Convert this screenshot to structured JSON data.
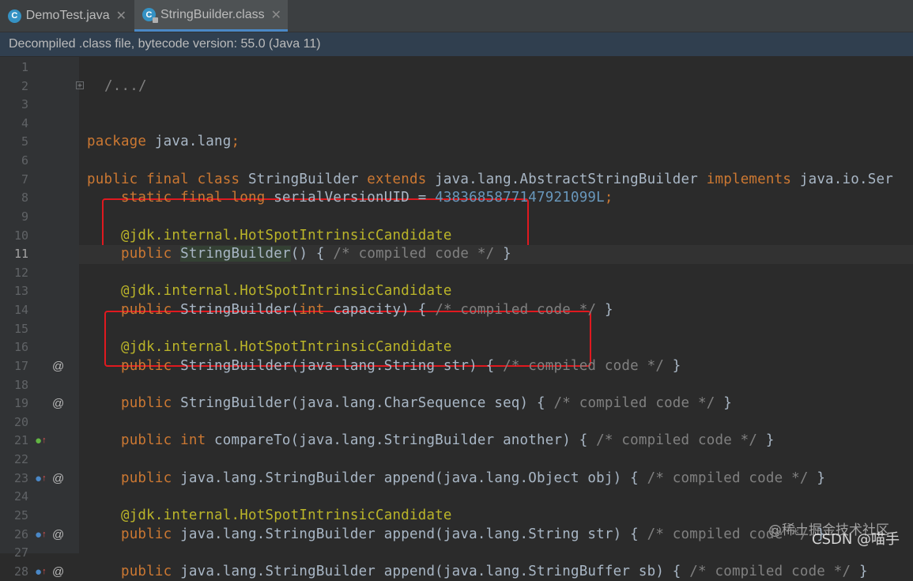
{
  "tabs": [
    {
      "label": "DemoTest.java",
      "icon": "java-class-icon",
      "active": false
    },
    {
      "label": "StringBuilder.class",
      "icon": "compiled-class-icon",
      "active": true
    }
  ],
  "notice": "Decompiled .class file, bytecode version: 55.0 (Java 11)",
  "lines": [
    {
      "n": "1",
      "html": ""
    },
    {
      "n": "2",
      "html": "<span class='cm' style='margin-left:22px'>/.../</span>"
    },
    {
      "n": "3",
      "html": ""
    },
    {
      "n": "4",
      "html": ""
    },
    {
      "n": "5",
      "html": "<span class='kw'>package</span> java.lang<span class='kw'>;</span>"
    },
    {
      "n": "6",
      "html": ""
    },
    {
      "n": "7",
      "html": "<span class='kw'>public final class</span> StringBuilder <span class='kw'>extends</span> java.lang.AbstractStringBuilder <span class='kw'>implements</span> java.io.Ser"
    },
    {
      "n": "8",
      "html": "    <span class='kw'>static final long</span> serialVersionUID = <span class='num'>4383685877147921099L</span><span class='kw'>;</span>"
    },
    {
      "n": "9",
      "html": ""
    },
    {
      "n": "10",
      "html": "    <span class='an'>@jdk.internal.HotSpotIntrinsicCandidate</span>"
    },
    {
      "n": "11",
      "html": "    <span class='kw'>public</span> <span class='hl'>StringBuilder</span>() { <span class='cm'>/* compiled code */</span> }"
    },
    {
      "n": "12",
      "html": ""
    },
    {
      "n": "13",
      "html": "    <span class='an'>@jdk.internal.HotSpotIntrinsicCandidate</span>"
    },
    {
      "n": "14",
      "html": "    <span class='kw'>public</span> StringBuilder(<span class='kw'>int</span> capacity) { <span class='cm'>/* compiled code */</span> }"
    },
    {
      "n": "15",
      "html": ""
    },
    {
      "n": "16",
      "html": "    <span class='an'>@jdk.internal.HotSpotIntrinsicCandidate</span>"
    },
    {
      "n": "17",
      "html": "    <span class='kw'>public</span> StringBuilder(java.lang.String str) { <span class='cm'>/* compiled code */</span> }"
    },
    {
      "n": "18",
      "html": ""
    },
    {
      "n": "19",
      "html": "    <span class='kw'>public</span> StringBuilder(java.lang.CharSequence seq) { <span class='cm'>/* compiled code */</span> }"
    },
    {
      "n": "20",
      "html": ""
    },
    {
      "n": "21",
      "html": "    <span class='kw'>public int</span> compareTo(java.lang.StringBuilder another) { <span class='cm'>/* compiled code */</span> }"
    },
    {
      "n": "22",
      "html": ""
    },
    {
      "n": "23",
      "html": "    <span class='kw'>public</span> java.lang.StringBuilder append(java.lang.Object obj) { <span class='cm'>/* compiled code */</span> }"
    },
    {
      "n": "24",
      "html": ""
    },
    {
      "n": "25",
      "html": "    <span class='an'>@jdk.internal.HotSpotIntrinsicCandidate</span>"
    },
    {
      "n": "26",
      "html": "    <span class='kw'>public</span> java.lang.StringBuilder append(java.lang.String str) { <span class='cm'>/* compiled code */</span> }"
    },
    {
      "n": "27",
      "html": ""
    },
    {
      "n": "28",
      "html": "    <span class='kw'>public</span> java.lang.StringBuilder append(java.lang.StringBuffer sb) { <span class='cm'>/* compiled code */</span> }"
    }
  ],
  "gutter_marks": [
    {
      "line": 17,
      "mark": "@"
    },
    {
      "line": 19,
      "mark": "@"
    },
    {
      "line": 21,
      "mark": "override"
    },
    {
      "line": 23,
      "mark": "override-@"
    },
    {
      "line": 26,
      "mark": "override-@"
    },
    {
      "line": 28,
      "mark": "override-@"
    }
  ],
  "watermark": {
    "line1": "@稀土掘金技术社区",
    "line2": "CSDN @喵手"
  },
  "colors": {
    "keyword": "#cc7832",
    "comment": "#808080",
    "annotation": "#bbb529",
    "number": "#6897bb",
    "highlight_box": "#e0191f"
  }
}
